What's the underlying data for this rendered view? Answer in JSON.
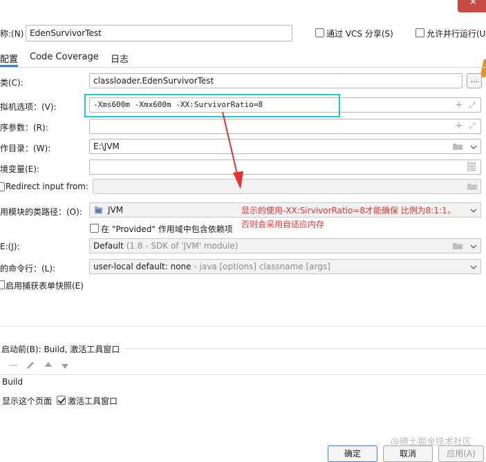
{
  "header": {
    "name_label": "称:(N)",
    "name_value": "EdenSurvivorTest",
    "vcs_share_label": "通过 VCS 分享(S)",
    "allow_parallel_label": "允许并行运行(U"
  },
  "tabs": [
    {
      "label": "配置",
      "active": true
    },
    {
      "label": "Code Coverage",
      "active": false
    },
    {
      "label": "日志",
      "active": false
    }
  ],
  "form": {
    "main_class_label": "类(C):",
    "main_class_value": "classloader.EdenSurvivorTest",
    "more_button": "...",
    "vm_options_label": "拟机选项：(V):",
    "vm_options_value": "-Xms600m -Xmx600m -XX:SurvivorRatio=8",
    "program_args_label": "序参数：(R):",
    "program_args_value": "",
    "workdir_label": "作目录：(W):",
    "workdir_value": "E:\\JVM",
    "env_vars_label": "境变量(E):",
    "env_vars_value": "",
    "redirect_label": "Redirect input from:",
    "classpath_label": "用模块的类路径：(O):",
    "classpath_value": "JVM",
    "provided_label": "在 \"Provided\" 作用域中包含依赖项",
    "jre_label": "E:(J):",
    "jre_default": "Default",
    "jre_hint": "(1.8 - SDK of 'JVM' module)",
    "shorten_label": "的命令行：(L):",
    "shorten_value": "user-local default: none",
    "shorten_hint": "- java [options] classname [args]",
    "snapshot_label": "启用捕获表单快照(E)"
  },
  "annotation": {
    "line1": "显示的使用-XX:SirvivorRatio=8才能确保 比例为8:1:1，",
    "line2": "否则会采用自适应内存"
  },
  "before_launch": {
    "title": "启动前(B): Build, 激活工具窗口",
    "item": "Build",
    "show_page_label": "显示这个页面",
    "activate_tool_label": "激活工具窗口"
  },
  "footer": {
    "ok_label": "确定",
    "cancel_label": "取消",
    "apply_label": "应用(A)",
    "watermark": "@稀土掘金技术社区"
  },
  "colors": {
    "highlight_box": "#22c5d4",
    "annotation": "#e8312a",
    "tab_indicator": "#3d7fd6",
    "close_button": "#d9534f"
  }
}
